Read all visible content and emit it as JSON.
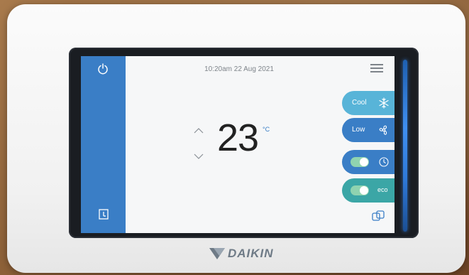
{
  "screen": {
    "datetime": "10:20am 22 Aug 2021",
    "temperature": "23",
    "unit": "°C"
  },
  "controls": {
    "mode_label": "Cool",
    "fan_label": "Low",
    "eco_label": "eco",
    "timer_enabled": true,
    "eco_enabled": true
  },
  "icons": {
    "power": "power-icon",
    "menu": "menu-icon",
    "exit": "exit-icon",
    "mode": "snowflake-icon",
    "fan": "fan-icon",
    "timer": "clock-icon",
    "multi_mode": "overlap-squares-icon"
  },
  "brand": {
    "name": "DAIKIN"
  },
  "colors": {
    "accent_blue": "#3a7ec6",
    "cool_blue": "#58b4d8",
    "eco_teal": "#3ba6a6",
    "toggle_green": "#8fd3b0"
  }
}
